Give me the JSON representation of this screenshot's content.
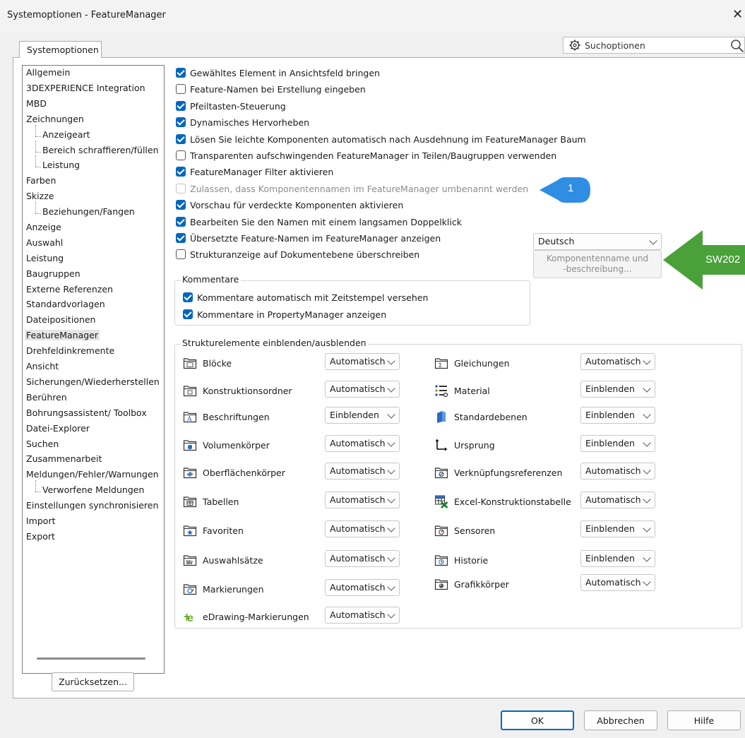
{
  "window": {
    "title": "Systemoptionen - FeatureManager",
    "close_glyph": "✕"
  },
  "tab": {
    "label": "Systemoptionen"
  },
  "search": {
    "placeholder": "Suchoptionen",
    "icon": "gear-icon",
    "search_icon": "magnifier-icon"
  },
  "tree": {
    "items": [
      {
        "label": "Allgemein",
        "level": 0
      },
      {
        "label": "3DEXPERIENCE Integration",
        "level": 0
      },
      {
        "label": "MBD",
        "level": 0
      },
      {
        "label": "Zeichnungen",
        "level": 0
      },
      {
        "label": "Anzeigeart",
        "level": 1
      },
      {
        "label": "Bereich schraffieren/füllen",
        "level": 1
      },
      {
        "label": "Leistung",
        "level": 1
      },
      {
        "label": "Farben",
        "level": 0
      },
      {
        "label": "Skizze",
        "level": 0
      },
      {
        "label": "Beziehungen/Fangen",
        "level": 1
      },
      {
        "label": "Anzeige",
        "level": 0
      },
      {
        "label": "Auswahl",
        "level": 0
      },
      {
        "label": "Leistung",
        "level": 0
      },
      {
        "label": "Baugruppen",
        "level": 0
      },
      {
        "label": "Externe Referenzen",
        "level": 0
      },
      {
        "label": "Standardvorlagen",
        "level": 0
      },
      {
        "label": "Dateipositionen",
        "level": 0
      },
      {
        "label": "FeatureManager",
        "level": 0,
        "selected": true
      },
      {
        "label": "Drehfeldinkremente",
        "level": 0
      },
      {
        "label": "Ansicht",
        "level": 0
      },
      {
        "label": "Sicherungen/Wiederherstellen",
        "level": 0
      },
      {
        "label": "Berühren",
        "level": 0
      },
      {
        "label": "Bohrungsassistent/ Toolbox",
        "level": 0
      },
      {
        "label": "Datei-Explorer",
        "level": 0
      },
      {
        "label": "Suchen",
        "level": 0
      },
      {
        "label": "Zusammenarbeit",
        "level": 0
      },
      {
        "label": "Meldungen/Fehler/Warnungen",
        "level": 0
      },
      {
        "label": "Verworfene Meldungen",
        "level": 1
      },
      {
        "label": "Einstellungen synchronisieren",
        "level": 0
      },
      {
        "label": "Import",
        "level": 0
      },
      {
        "label": "Export",
        "level": 0
      }
    ],
    "reset_button": "Zurücksetzen..."
  },
  "options": [
    {
      "label": "Gewähltes Element in Ansichtsfeld bringen",
      "state": "checked"
    },
    {
      "label": "Feature-Namen bei Erstellung eingeben",
      "state": "unchecked"
    },
    {
      "label": "Pfeiltasten-Steuerung",
      "state": "checked"
    },
    {
      "label": "Dynamisches Hervorheben",
      "state": "checked"
    },
    {
      "label": "Lösen Sie leichte Komponenten automatisch nach Ausdehnung im FeatureManager Baum",
      "state": "checked"
    },
    {
      "label": "Transparenten aufschwingenden FeatureManager in Teilen/Baugruppen verwenden",
      "state": "unchecked"
    },
    {
      "label": "FeatureManager Filter aktivieren",
      "state": "checked"
    },
    {
      "label": "Zulassen, dass Komponentennamen im FeatureManager umbenannt werden",
      "state": "disabled"
    },
    {
      "label": "Vorschau für verdeckte Komponenten aktivieren",
      "state": "checked"
    },
    {
      "label": "Bearbeiten Sie den Namen mit einem langsamen Doppelklick",
      "state": "checked"
    },
    {
      "label": "Übersetzte Feature-Namen im FeatureManager anzeigen",
      "state": "checked"
    },
    {
      "label": "Strukturanzeige auf Dokumentebene überschreiben",
      "state": "unchecked"
    }
  ],
  "callout": {
    "number": "1",
    "color": "#2f8de4"
  },
  "language_select": {
    "value": "Deutsch"
  },
  "component_button": {
    "line1": "Komponentenname und",
    "line2": "-beschreibung..."
  },
  "arrow_banner": {
    "text": "SW202",
    "color": "#4aa13a"
  },
  "comments": {
    "title": "Kommentare",
    "items": [
      {
        "label": "Kommentare automatisch mit Zeitstempel versehen",
        "state": "checked"
      },
      {
        "label": "Kommentare in PropertyManager anzeigen",
        "state": "checked"
      }
    ]
  },
  "structure": {
    "title": "Strukturelemente einblenden/ausblenden",
    "left": [
      {
        "label": "Blöcke",
        "value": "Automatisch",
        "icon": "blocks-folder-icon"
      },
      {
        "label": "Konstruktionsordner",
        "value": "Automatisch",
        "icon": "design-folder-icon"
      },
      {
        "label": "Beschriftungen",
        "value": "Einblenden",
        "icon": "annotations-folder-icon"
      },
      {
        "label": "Volumenkörper",
        "value": "Automatisch",
        "icon": "solid-bodies-folder-icon"
      },
      {
        "label": "Oberflächenkörper",
        "value": "Automatisch",
        "icon": "surface-bodies-folder-icon"
      },
      {
        "label": "Tabellen",
        "value": "Automatisch",
        "icon": "tables-folder-icon"
      },
      {
        "label": "Favoriten",
        "value": "Automatisch",
        "icon": "favorites-folder-icon"
      },
      {
        "label": "Auswahlsätze",
        "value": "Automatisch",
        "icon": "selection-sets-folder-icon"
      },
      {
        "label": "Markierungen",
        "value": "Automatisch",
        "icon": "markups-folder-icon"
      },
      {
        "label": "eDrawing-Markierungen",
        "value": "Automatisch",
        "icon": "edrawings-icon"
      }
    ],
    "right": [
      {
        "label": "Gleichungen",
        "value": "Automatisch",
        "icon": "equations-folder-icon"
      },
      {
        "label": "Material",
        "value": "Einblenden",
        "icon": "material-icon"
      },
      {
        "label": "Standardebenen",
        "value": "Einblenden",
        "icon": "planes-icon"
      },
      {
        "label": "Ursprung",
        "value": "Einblenden",
        "icon": "origin-icon"
      },
      {
        "label": "Verknüpfungsreferenzen",
        "value": "Automatisch",
        "icon": "mate-references-folder-icon"
      },
      {
        "label": "Excel-Konstruktionstabelle",
        "value": "Automatisch",
        "icon": "excel-design-table-icon"
      },
      {
        "label": "Sensoren",
        "value": "Einblenden",
        "icon": "sensors-folder-icon"
      },
      {
        "label": "Historie",
        "value": "Einblenden",
        "icon": "history-folder-icon"
      },
      {
        "label": "Grafikkörper",
        "value": "Automatisch",
        "icon": "graphics-bodies-folder-icon"
      }
    ]
  },
  "footer": {
    "ok": "OK",
    "cancel": "Abbrechen",
    "help": "Hilfe"
  }
}
